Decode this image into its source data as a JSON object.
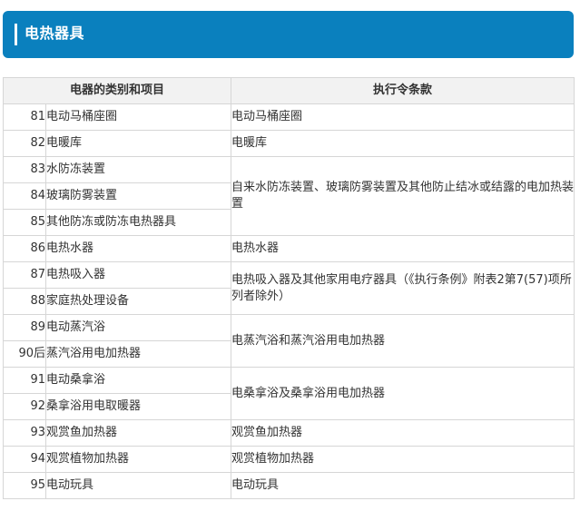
{
  "header": {
    "title": "电热器具"
  },
  "table": {
    "col_category": "电器的类别和项目",
    "col_rule": "执行令条款",
    "groups": [
      {
        "rule": "电动马桶座圈",
        "items": [
          {
            "num": "81",
            "name": "电动马桶座圈"
          }
        ]
      },
      {
        "rule": "电暖库",
        "items": [
          {
            "num": "82",
            "name": "电暖库"
          }
        ]
      },
      {
        "rule": "自来水防冻装置、玻璃防雾装置及其他防止结冰或结露的电加热装置",
        "items": [
          {
            "num": "83",
            "name": "水防冻装置"
          },
          {
            "num": "84",
            "name": "玻璃防雾装置"
          },
          {
            "num": "85",
            "name": "其他防冻或防冻电热器具"
          }
        ]
      },
      {
        "rule": "电热水器",
        "items": [
          {
            "num": "86",
            "name": "电热水器"
          }
        ]
      },
      {
        "rule": "电热吸入器及其他家用电疗器具（《执行条例》附表2第7(57)项所列者除外）",
        "items": [
          {
            "num": "87",
            "name": "电热吸入器"
          },
          {
            "num": "88",
            "name": "家庭热处理设备"
          }
        ]
      },
      {
        "rule": "电蒸汽浴和蒸汽浴用电加热器",
        "items": [
          {
            "num": "89",
            "name": "电动蒸汽浴"
          },
          {
            "num": "90后",
            "name": "蒸汽浴用电加热器"
          }
        ]
      },
      {
        "rule": "电桑拿浴及桑拿浴用电加热器",
        "items": [
          {
            "num": "91",
            "name": "电动桑拿浴"
          },
          {
            "num": "92",
            "name": "桑拿浴用电取暖器"
          }
        ]
      },
      {
        "rule": "观赏鱼加热器",
        "items": [
          {
            "num": "93",
            "name": "观赏鱼加热器"
          }
        ]
      },
      {
        "rule": "观赏植物加热器",
        "items": [
          {
            "num": "94",
            "name": "观赏植物加热器"
          }
        ]
      },
      {
        "rule": "电动玩具",
        "items": [
          {
            "num": "95",
            "name": "电动玩具"
          }
        ]
      }
    ]
  }
}
